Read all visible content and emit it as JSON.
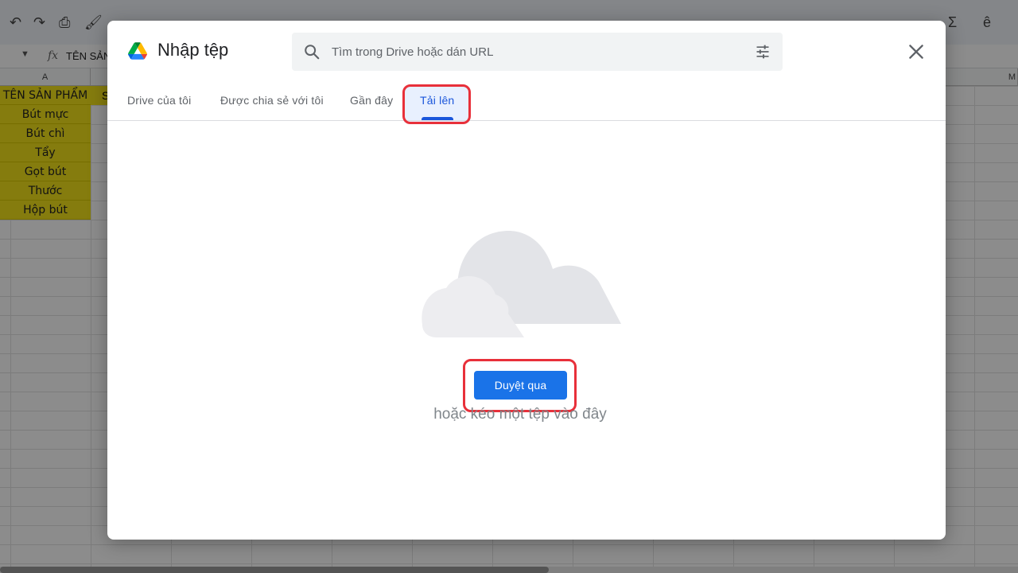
{
  "spreadsheet": {
    "formula_text": "TÊN SẢN",
    "columns": [
      "A",
      "",
      "",
      "",
      "",
      "",
      "",
      "",
      "",
      "",
      "",
      "",
      "M"
    ],
    "header_cell": "TÊN SẢN PHẨM",
    "header_cell_b": "S",
    "rows": [
      "Bút mực",
      "Bút chì",
      "Tẩy",
      "Gọt bút",
      "Thước",
      "Hộp bút"
    ],
    "highlight_color": "#f3e21a"
  },
  "dialog": {
    "title": "Nhập tệp",
    "search": {
      "placeholder": "Tìm trong Drive hoặc dán URL"
    },
    "tabs": [
      {
        "label": "Drive của tôi"
      },
      {
        "label": "Được chia sẻ với tôi"
      },
      {
        "label": "Gần đây"
      },
      {
        "label": "Tải lên",
        "active": true
      }
    ],
    "upload": {
      "browse_label": "Duyệt qua",
      "drag_hint": "hoặc kéo một tệp vào đây"
    },
    "icons": {
      "logo": "google-drive-logo",
      "search": "search-icon",
      "filter": "tune-icon",
      "close": "close-icon",
      "illustration": "cloud-illustration"
    },
    "colors": {
      "accent": "#1a73e8",
      "highlight_outline": "#e8303a",
      "active_tab_bg": "#e8f0fe"
    }
  }
}
